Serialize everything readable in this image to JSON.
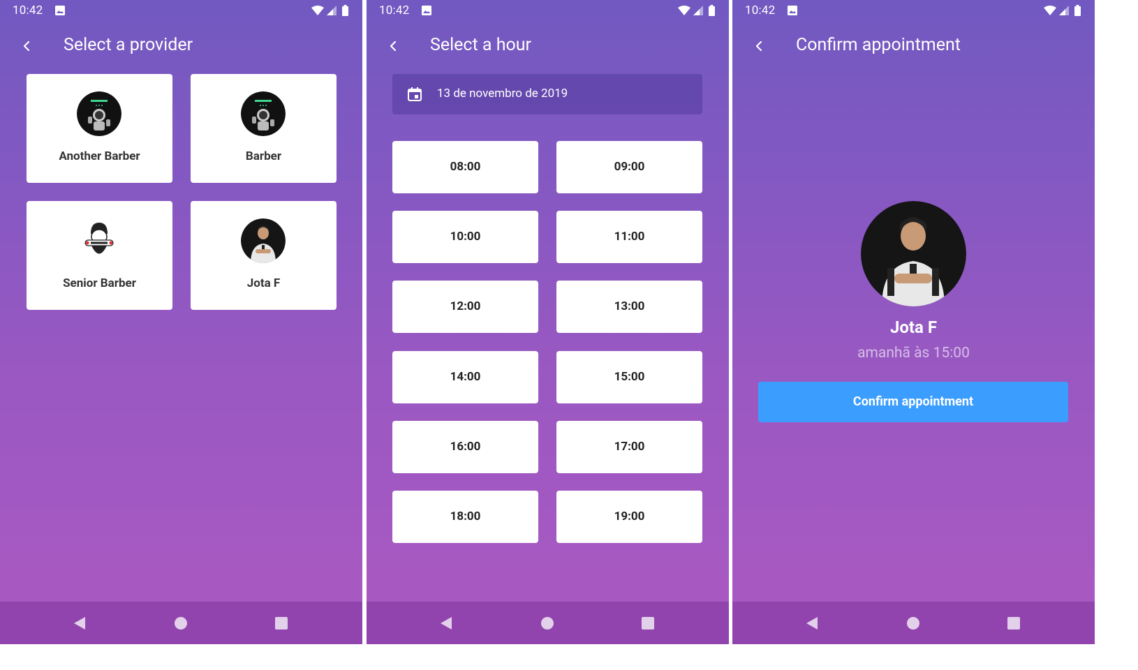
{
  "status_bar": {
    "time": "10:42"
  },
  "screens": [
    {
      "title": "Select a provider",
      "providers": [
        {
          "name": "Another Barber",
          "avatar": "rocketseat-astronaut-icon"
        },
        {
          "name": "Barber",
          "avatar": "rocketseat-astronaut-icon"
        },
        {
          "name": "Senior Barber",
          "avatar": "bearded-barber-icon"
        },
        {
          "name": "Jota F",
          "avatar": "person-photo"
        }
      ]
    },
    {
      "title": "Select a hour",
      "date": "13 de novembro de 2019",
      "hours": [
        "08:00",
        "09:00",
        "10:00",
        "11:00",
        "12:00",
        "13:00",
        "14:00",
        "15:00",
        "16:00",
        "17:00",
        "18:00",
        "19:00"
      ]
    },
    {
      "title": "Confirm appointment",
      "provider_name": "Jota F",
      "appointment_time": "amanhã às 15:00",
      "confirm_label": "Confirm appointment"
    }
  ],
  "colors": {
    "gradient_top": "#7159c1",
    "gradient_bottom": "#ab59c1",
    "confirm_button": "#3b9eff",
    "card": "#ffffff"
  }
}
